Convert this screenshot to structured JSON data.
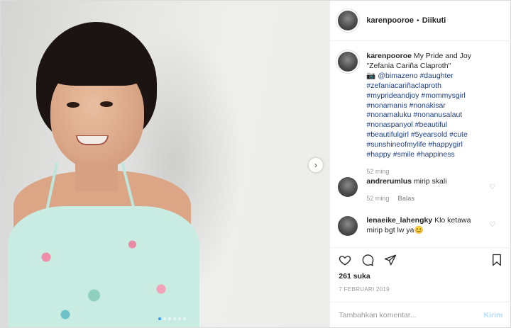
{
  "header": {
    "username": "karenpooroe",
    "separator": "•",
    "follow_status": "Diikuti"
  },
  "caption": {
    "username": "karenpooroe",
    "text_line1": "My Pride and Joy",
    "text_line2": "\"Zefania Cariña Claproth\"",
    "camera_emoji": "📷",
    "mention": "@bimazeno",
    "hashtags": "#daughter #zefaniacariñaclaproth #myprideandjoy #mommysgirl #nonamanis #nonakisar #nonamaluku #nonanusalaut #nonaspanyol #beautiful #beautifulgirl #5yearsold #cute #sunshineofmylife #happygirl #happy #smile #happiness",
    "time": "52 ming"
  },
  "comments": [
    {
      "username": "andrerumlus",
      "text": "mirip skali",
      "time": "52 ming",
      "reply_label": "Balas"
    },
    {
      "username": "lenaeike_lahengky",
      "text": "Klo ketawa mirip bgt lw ya😊"
    }
  ],
  "actions": {
    "likes": "261 suka",
    "date": "7 FEBRUARI 2019",
    "comment_placeholder": "Tambahkan komentar...",
    "send_label": "Kirim"
  },
  "media": {
    "next_glyph": "›",
    "slide_count": 6,
    "active_slide": 1
  }
}
